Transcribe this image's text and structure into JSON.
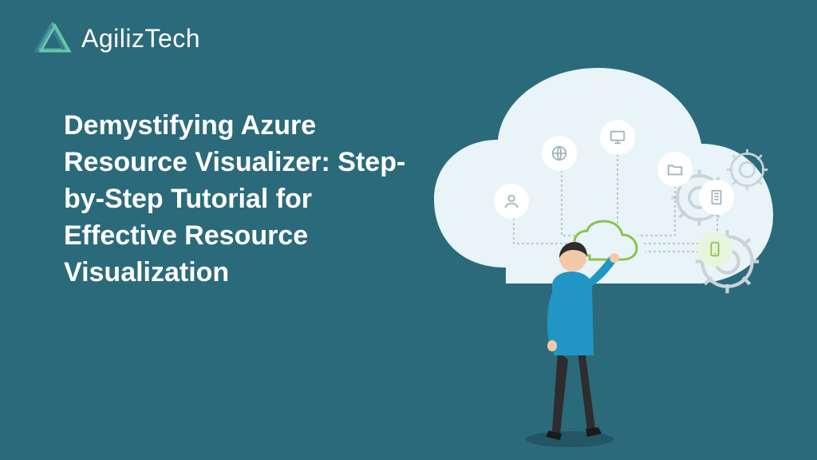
{
  "brand": {
    "name": "AgilizTech"
  },
  "headline": "Demystifying Azure Resource Visualizer: Step-by-Step Tutorial for Effective Resource Visualization",
  "colors": {
    "background": "#2b6a7a",
    "text": "#ffffff",
    "accent_green": "#8bc34a",
    "cloud_light": "#e8f4f8",
    "icon_gray": "#9fb5bc"
  },
  "icons": {
    "person": "person-icon",
    "globe": "globe-icon",
    "monitor": "monitor-icon",
    "folder": "folder-icon",
    "server": "server-icon",
    "mobile": "mobile-icon",
    "cloud": "cloud-icon",
    "gear": "gear-icon"
  }
}
